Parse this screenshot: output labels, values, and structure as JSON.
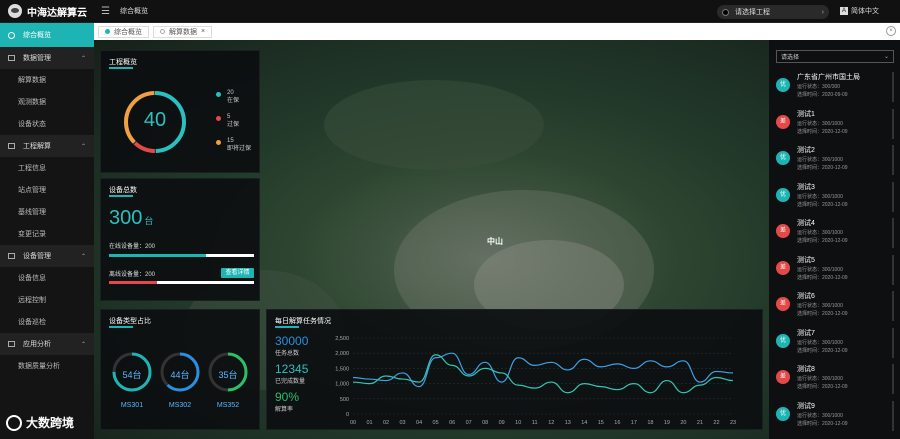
{
  "topbar": {
    "title": "中海达解算云",
    "crumb": "综合概览",
    "project_select": "请选择工程",
    "language": "简体中文"
  },
  "sidebar": {
    "active": "综合概览",
    "groups": [
      {
        "label": "数据管理",
        "items": [
          "解算数据",
          "观测数据",
          "设备状态"
        ]
      },
      {
        "label": "工程解算",
        "items": [
          "工程信息",
          "站点管理",
          "基线管理",
          "变更记录"
        ]
      },
      {
        "label": "设备管理",
        "items": [
          "设备信息",
          "远程控制",
          "设备巡检"
        ]
      },
      {
        "label": "应用分析",
        "items": [
          "数据质量分析"
        ]
      }
    ]
  },
  "tabs": [
    {
      "label": "综合概览",
      "active": true
    },
    {
      "label": "解算数据",
      "active": false
    }
  ],
  "map": {
    "city_label": "中山"
  },
  "project_overview": {
    "title": "工程概览",
    "total": "40",
    "legend": [
      {
        "value": "20",
        "label": "在保",
        "color": "#2bbfbf"
      },
      {
        "value": "5",
        "label": "过保",
        "color": "#e24a4a"
      },
      {
        "value": "15",
        "label": "即将过保",
        "color": "#f0a043"
      }
    ]
  },
  "device_total": {
    "title": "设备总数",
    "value": "300",
    "unit": "台",
    "online_label": "在线设备量：200",
    "offline_label": "离线设备量：200",
    "detail_button": "查看详情",
    "online_fraction": 0.67,
    "offline_fraction": 0.33
  },
  "device_types": {
    "title": "设备类型占比",
    "items": [
      {
        "value": "54台",
        "name": "MS301",
        "fraction": 0.75,
        "color": "#1fb4b4"
      },
      {
        "value": "44台",
        "name": "MS302",
        "fraction": 0.62,
        "color": "#2a8fe0"
      },
      {
        "value": "35台",
        "name": "MS352",
        "fraction": 0.5,
        "color": "#2bbf6a"
      }
    ]
  },
  "daily_tasks": {
    "title": "每日解算任务情况",
    "stats": [
      {
        "value": "30000",
        "label": "任务总数"
      },
      {
        "value": "12345",
        "label": "已完成数量"
      },
      {
        "value": "90%",
        "label": "解算率"
      }
    ]
  },
  "chart_data": {
    "type": "line",
    "title": "每日解算任务情况",
    "categories": [
      "00",
      "01",
      "02",
      "03",
      "04",
      "05",
      "06",
      "07",
      "08",
      "09",
      "10",
      "11",
      "12",
      "13",
      "14",
      "15",
      "16",
      "17",
      "18",
      "19",
      "20",
      "21",
      "22",
      "23"
    ],
    "ylim": [
      0,
      2500
    ],
    "yticks": [
      "0",
      "500",
      "1,000",
      "1,500",
      "2,000",
      "2,500"
    ],
    "series": [
      {
        "color": "#3fa0e8",
        "values": [
          1200,
          1150,
          1100,
          1350,
          900,
          1850,
          2000,
          1300,
          1700,
          1050,
          1850,
          1600,
          1700,
          1450,
          1800,
          1550,
          1650,
          1500,
          1750,
          1550,
          1750,
          1050,
          1400,
          1350
        ]
      },
      {
        "color": "#35c4b0",
        "values": [
          1050,
          1000,
          1250,
          1150,
          1050,
          1950,
          1600,
          1250,
          1500,
          1350,
          950,
          850,
          1050,
          700,
          1000,
          900,
          800,
          1000,
          700,
          1100,
          700,
          950,
          1200,
          1100
        ]
      }
    ]
  },
  "right_panel": {
    "select": "请选择",
    "items": [
      {
        "badge": "优",
        "color": "#1fb4b4",
        "name": "广东省广州市国土局",
        "l1": "运行状态：300/300",
        "l2": "选择时间：2020-09-09"
      },
      {
        "badge": "差",
        "color": "#e24a4a",
        "name": "测试1",
        "l1": "运行状态：300/1000",
        "l2": "选择时间：2020-12-09"
      },
      {
        "badge": "优",
        "color": "#1fb4b4",
        "name": "测试2",
        "l1": "运行状态：300/1000",
        "l2": "选择时间：2020-12-09"
      },
      {
        "badge": "优",
        "color": "#1fb4b4",
        "name": "测试3",
        "l1": "运行状态：300/1000",
        "l2": "选择时间：2020-12-09"
      },
      {
        "badge": "差",
        "color": "#e24a4a",
        "name": "测试4",
        "l1": "运行状态：300/1000",
        "l2": "选择时间：2020-12-09"
      },
      {
        "badge": "差",
        "color": "#e24a4a",
        "name": "测试5",
        "l1": "运行状态：300/1000",
        "l2": "选择时间：2020-12-09"
      },
      {
        "badge": "差",
        "color": "#e24a4a",
        "name": "测试6",
        "l1": "运行状态：300/1000",
        "l2": "选择时间：2020-12-09"
      },
      {
        "badge": "优",
        "color": "#1fb4b4",
        "name": "测试7",
        "l1": "运行状态：300/1000",
        "l2": "选择时间：2020-12-09"
      },
      {
        "badge": "差",
        "color": "#e24a4a",
        "name": "测试8",
        "l1": "运行状态：300/1000",
        "l2": "选择时间：2020-12-09"
      },
      {
        "badge": "优",
        "color": "#1fb4b4",
        "name": "测试9",
        "l1": "运行状态：300/1000",
        "l2": "选择时间：2020-12-09"
      }
    ]
  },
  "watermark": "大数跨境"
}
